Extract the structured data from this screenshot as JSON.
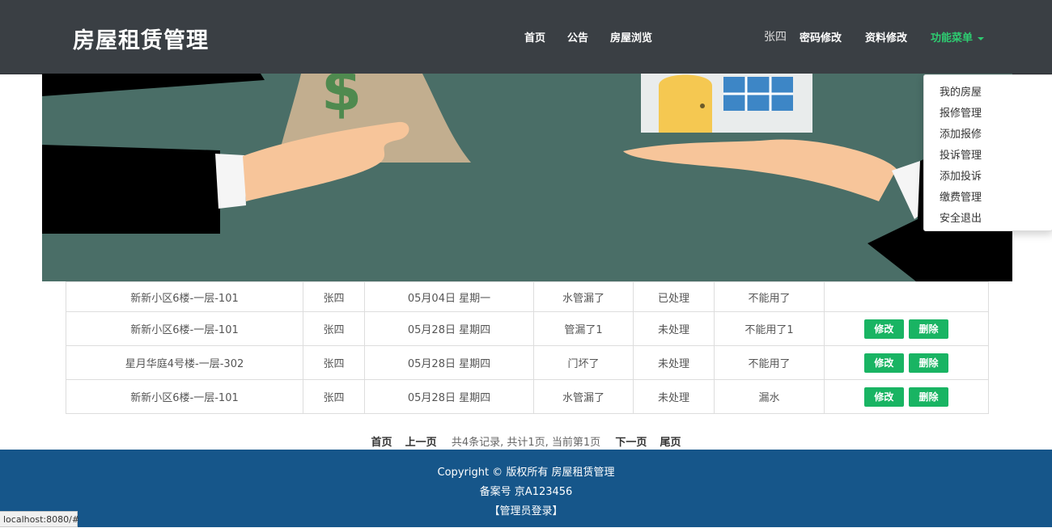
{
  "header": {
    "brand": "房屋租赁管理",
    "nav": [
      "首页",
      "公告",
      "房屋浏览"
    ],
    "user": "张四",
    "password_link": "密码修改",
    "profile_link": "资料修改",
    "menu_label": "功能菜单"
  },
  "dropdown": {
    "items": [
      "我的房屋",
      "报修管理",
      "添加报修",
      "投诉管理",
      "添加投诉",
      "缴费管理",
      "安全退出"
    ]
  },
  "table": {
    "edit_label": "修改",
    "delete_label": "删除",
    "rows": [
      {
        "house": "新新小区6楼-一层-101",
        "user": "张四",
        "date": "05月04日 星期一",
        "title": "水管漏了",
        "status": "已处理",
        "note": "不能用了",
        "actions": false
      },
      {
        "house": "新新小区6楼-一层-101",
        "user": "张四",
        "date": "05月28日 星期四",
        "title": "管漏了1",
        "status": "未处理",
        "note": "不能用了1",
        "actions": true
      },
      {
        "house": "星月华庭4号楼-一层-302",
        "user": "张四",
        "date": "05月28日 星期四",
        "title": "门坏了",
        "status": "未处理",
        "note": "不能用了",
        "actions": true
      },
      {
        "house": "新新小区6楼-一层-101",
        "user": "张四",
        "date": "05月28日 星期四",
        "title": "水管漏了",
        "status": "未处理",
        "note": "漏水",
        "actions": true
      }
    ]
  },
  "pager": {
    "first": "首页",
    "prev": "上一页",
    "info": "共4条记录, 共计1页, 当前第1页",
    "next": "下一页",
    "last": "尾页"
  },
  "footer": {
    "copyright": "Copyright © 版权所有 房屋租赁管理",
    "icp": "备案号 京A123456",
    "admin_login": "【管理员登录】"
  },
  "status_bar": {
    "url": "localhost:8080/#"
  },
  "colors": {
    "navbar": "#3a3f44",
    "accent_green": "#19b463",
    "footer": "#16568a",
    "banner_bg": "#4a6e67"
  }
}
